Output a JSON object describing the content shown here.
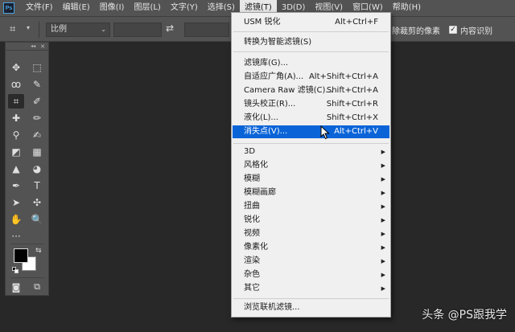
{
  "app": {
    "logo": "Ps"
  },
  "menubar": {
    "items": [
      "文件(F)",
      "编辑(E)",
      "图像(I)",
      "图层(L)",
      "文字(Y)",
      "选择(S)",
      "滤镜(T)",
      "3D(D)",
      "视图(V)",
      "窗口(W)",
      "帮助(H)"
    ],
    "active": "滤镜(T)"
  },
  "options": {
    "ratio_select": "比例",
    "delete_cropped_label": "除裁剪的像素",
    "content_aware_label": "内容识别",
    "content_aware_checked": true
  },
  "toolbar": {
    "header_collapse": "◂◂",
    "header_close": "✕",
    "tools": [
      {
        "name": "move-tool",
        "glyph": "✥"
      },
      {
        "name": "marquee-tool",
        "glyph": "⬚"
      },
      {
        "name": "lasso-tool",
        "glyph": "ꝏ"
      },
      {
        "name": "quick-select-tool",
        "glyph": "✎"
      },
      {
        "name": "crop-tool",
        "glyph": "⌗"
      },
      {
        "name": "eyedropper-tool",
        "glyph": "✐"
      },
      {
        "name": "healing-brush-tool",
        "glyph": "✚"
      },
      {
        "name": "brush-tool",
        "glyph": "✏"
      },
      {
        "name": "clone-stamp-tool",
        "glyph": "⚲"
      },
      {
        "name": "history-brush-tool",
        "glyph": "✍"
      },
      {
        "name": "eraser-tool",
        "glyph": "◩"
      },
      {
        "name": "gradient-tool",
        "glyph": "▦"
      },
      {
        "name": "blur-tool",
        "glyph": "▲"
      },
      {
        "name": "dodge-tool",
        "glyph": "◕"
      },
      {
        "name": "pen-tool",
        "glyph": "✒"
      },
      {
        "name": "type-tool",
        "glyph": "T"
      },
      {
        "name": "path-select-tool",
        "glyph": "➤"
      },
      {
        "name": "shape-tool",
        "glyph": "✣"
      },
      {
        "name": "hand-tool",
        "glyph": "✋"
      },
      {
        "name": "zoom-tool",
        "glyph": "🔍"
      },
      {
        "name": "more-tools",
        "glyph": "···"
      }
    ]
  },
  "filter_menu": {
    "items": [
      {
        "label": "USM 锐化",
        "shortcut": "Alt+Ctrl+F"
      },
      {
        "label": "转换为智能滤镜(S)",
        "shortcut": ""
      },
      {
        "label": "滤镜库(G)...",
        "shortcut": ""
      },
      {
        "label": "自适应广角(A)...",
        "shortcut": "Alt+Shift+Ctrl+A"
      },
      {
        "label": "Camera Raw 滤镜(C)...",
        "shortcut": "Shift+Ctrl+A"
      },
      {
        "label": "镜头校正(R)...",
        "shortcut": "Shift+Ctrl+R"
      },
      {
        "label": "液化(L)...",
        "shortcut": "Shift+Ctrl+X"
      },
      {
        "label": "消失点(V)...",
        "shortcut": "Alt+Ctrl+V"
      },
      {
        "label": "3D",
        "shortcut": ""
      },
      {
        "label": "风格化",
        "shortcut": ""
      },
      {
        "label": "模糊",
        "shortcut": ""
      },
      {
        "label": "模糊画廊",
        "shortcut": ""
      },
      {
        "label": "扭曲",
        "shortcut": ""
      },
      {
        "label": "锐化",
        "shortcut": ""
      },
      {
        "label": "视频",
        "shortcut": ""
      },
      {
        "label": "像素化",
        "shortcut": ""
      },
      {
        "label": "渲染",
        "shortcut": ""
      },
      {
        "label": "杂色",
        "shortcut": ""
      },
      {
        "label": "其它",
        "shortcut": ""
      },
      {
        "label": "浏览联机滤镜...",
        "shortcut": ""
      }
    ],
    "highlighted": "消失点(V)..."
  },
  "colors": {
    "foreground": "#000000",
    "background": "#ffffff",
    "highlight": "#0a64d8"
  },
  "watermark": "头条 @PS跟我学"
}
